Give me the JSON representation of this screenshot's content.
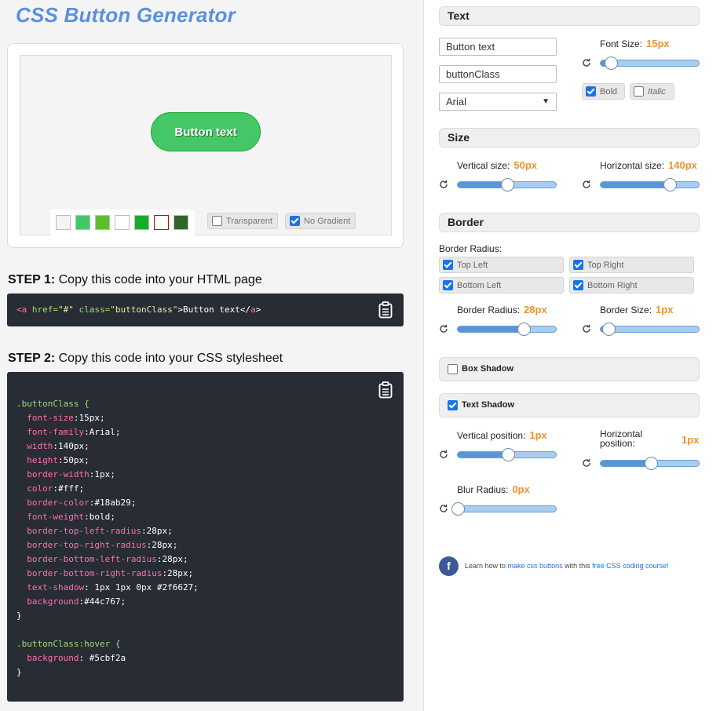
{
  "title": "CSS Button Generator",
  "preview": {
    "button_text": "Button text",
    "swatches": [
      "#f4f4f4",
      "#44c767",
      "#5cbf2a",
      "#ffffff",
      "#18ab29",
      "#ffffff",
      "#2f6627"
    ],
    "swatch_selected_border": "#d0021b",
    "transparent_label": "Transparent",
    "transparent_checked": false,
    "no_gradient_label": "No Gradient",
    "no_gradient_checked": true
  },
  "step1": {
    "label": "STEP 1:",
    "text": "Copy this code into your HTML page",
    "code": {
      "open_tag": "<a",
      "attr1": "href=",
      "val1": "\"#\"",
      "attr2": "class=",
      "val2": "\"buttonClass\"",
      "inner": ">Button text</",
      "close_tag": "a",
      "end": ">"
    }
  },
  "step2": {
    "label": "STEP 2:",
    "text": "Copy this code into your CSS stylesheet",
    "rule1_selector": ".buttonClass {",
    "declarations": [
      {
        "prop": "font-size",
        "value": ":15px;"
      },
      {
        "prop": "font-family",
        "value": ":Arial;"
      },
      {
        "prop": "width",
        "value": ":140px;"
      },
      {
        "prop": "height",
        "value": ":50px;"
      },
      {
        "prop": "border-width",
        "value": ":1px;"
      },
      {
        "prop": "color",
        "value": ":#fff;"
      },
      {
        "prop": "border-color",
        "value": ":#18ab29;"
      },
      {
        "prop": "font-weight",
        "value": ":bold;"
      },
      {
        "prop": "border-top-left-radius",
        "value": ":28px;"
      },
      {
        "prop": "border-top-right-radius",
        "value": ":28px;"
      },
      {
        "prop": "border-bottom-left-radius",
        "value": ":28px;"
      },
      {
        "prop": "border-bottom-right-radius",
        "value": ":28px;"
      },
      {
        "prop": "text-shadow",
        "value": ": 1px 1px 0px #2f6627;"
      },
      {
        "prop": "background",
        "value": ":#44c767;"
      }
    ],
    "close": "}",
    "rule2_selector": ".buttonClass:hover {",
    "hover_prop": "background",
    "hover_value": ": #5cbf2a"
  },
  "text_section": {
    "header": "Text",
    "button_text_value": "Button text",
    "class_value": "buttonClass",
    "font_value": "Arial",
    "font_size_label": "Font Size:",
    "font_size_value": "15px",
    "font_size_level": 0.1,
    "bold_label": "Bold",
    "bold_checked": true,
    "italic_label": "Italic",
    "italic_checked": false
  },
  "size_section": {
    "header": "Size",
    "vertical_label": "Vertical size:",
    "vertical_value": "50px",
    "vertical_level": 0.5,
    "horizontal_label": "Horizontal size:",
    "horizontal_value": "140px",
    "horizontal_level": 0.7
  },
  "border_section": {
    "header": "Border",
    "radius_title": "Border Radius:",
    "corners": [
      {
        "label": "Top Left",
        "checked": true
      },
      {
        "label": "Top Right",
        "checked": true
      },
      {
        "label": "Bottom Left",
        "checked": true
      },
      {
        "label": "Bottom Right",
        "checked": true
      }
    ],
    "radius_label": "Border Radius:",
    "radius_value": "28px",
    "radius_level": 0.67,
    "size_label": "Border Size:",
    "size_value": "1px",
    "size_level": 0.08
  },
  "box_shadow": {
    "label": "Box Shadow",
    "checked": false
  },
  "text_shadow": {
    "label": "Text Shadow",
    "checked": true,
    "vertical_label": "Vertical position:",
    "vertical_value": "1px",
    "vertical_level": 0.51,
    "horizontal_label": "Horizontal position:",
    "horizontal_value": "1px",
    "horizontal_level": 0.51,
    "blur_label": "Blur Radius:",
    "blur_value": "0px",
    "blur_level": 0.0
  },
  "footer": {
    "icon": "facebook-icon",
    "pre": "Learn how to ",
    "link1": "make css buttons",
    "mid": " with this ",
    "link2": "free CSS coding course!"
  },
  "colors": {
    "accent": "#5b8fe0",
    "value_orange": "#f0932b",
    "code_bg": "#282c34",
    "button_green": "#44c767"
  }
}
